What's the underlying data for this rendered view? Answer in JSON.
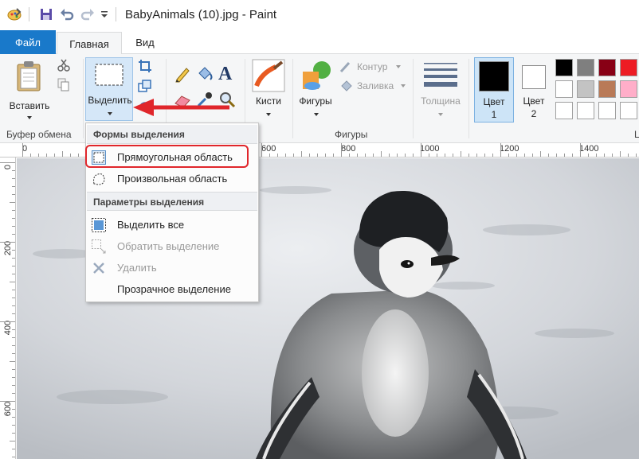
{
  "window": {
    "title": "BabyAnimals (10).jpg - Paint"
  },
  "tabs": {
    "file": "Файл",
    "home": "Главная",
    "view": "Вид"
  },
  "ribbon": {
    "paste_label": "Вставить",
    "clipboard_group": "Буфер обмена",
    "select_label": "Выделить",
    "brushes_label": "Кисти",
    "shapes_label": "Фигуры",
    "outline_label": "Контур",
    "fill_label": "Заливка",
    "shapes_group": "Фигуры",
    "size_label": "Толщина",
    "color1_label_line1": "Цвет",
    "color1_label_line2": "1",
    "color2_label_line1": "Цвет",
    "color2_label_line2": "2",
    "colors_group_partial": "Ц"
  },
  "palette": {
    "row1": [
      "#000000",
      "#7f7f7f",
      "#880015",
      "#ed1c24"
    ],
    "row2": [
      "#ffffff",
      "#c3c3c3",
      "#b97a57",
      "#ffaec9"
    ],
    "row3": [
      "#ffffff",
      "#ffffff",
      "#ffffff",
      "#ffffff"
    ]
  },
  "colors": {
    "accent": "#1979ca",
    "highlight": "#e0262b",
    "color1": "#000000",
    "color2": "#ffffff"
  },
  "ruler": {
    "top": [
      "0",
      "600",
      "800",
      "1000",
      "1200",
      "1400"
    ],
    "left": [
      "0",
      "200",
      "400",
      "600"
    ]
  },
  "menu": {
    "section1": "Формы выделения",
    "rect_select": "Прямоугольная область",
    "free_select": "Произвольная область",
    "section2": "Параметры выделения",
    "select_all": "Выделить все",
    "invert": "Обратить выделение",
    "delete": "Удалить",
    "transparent": "Прозрачное выделение"
  }
}
